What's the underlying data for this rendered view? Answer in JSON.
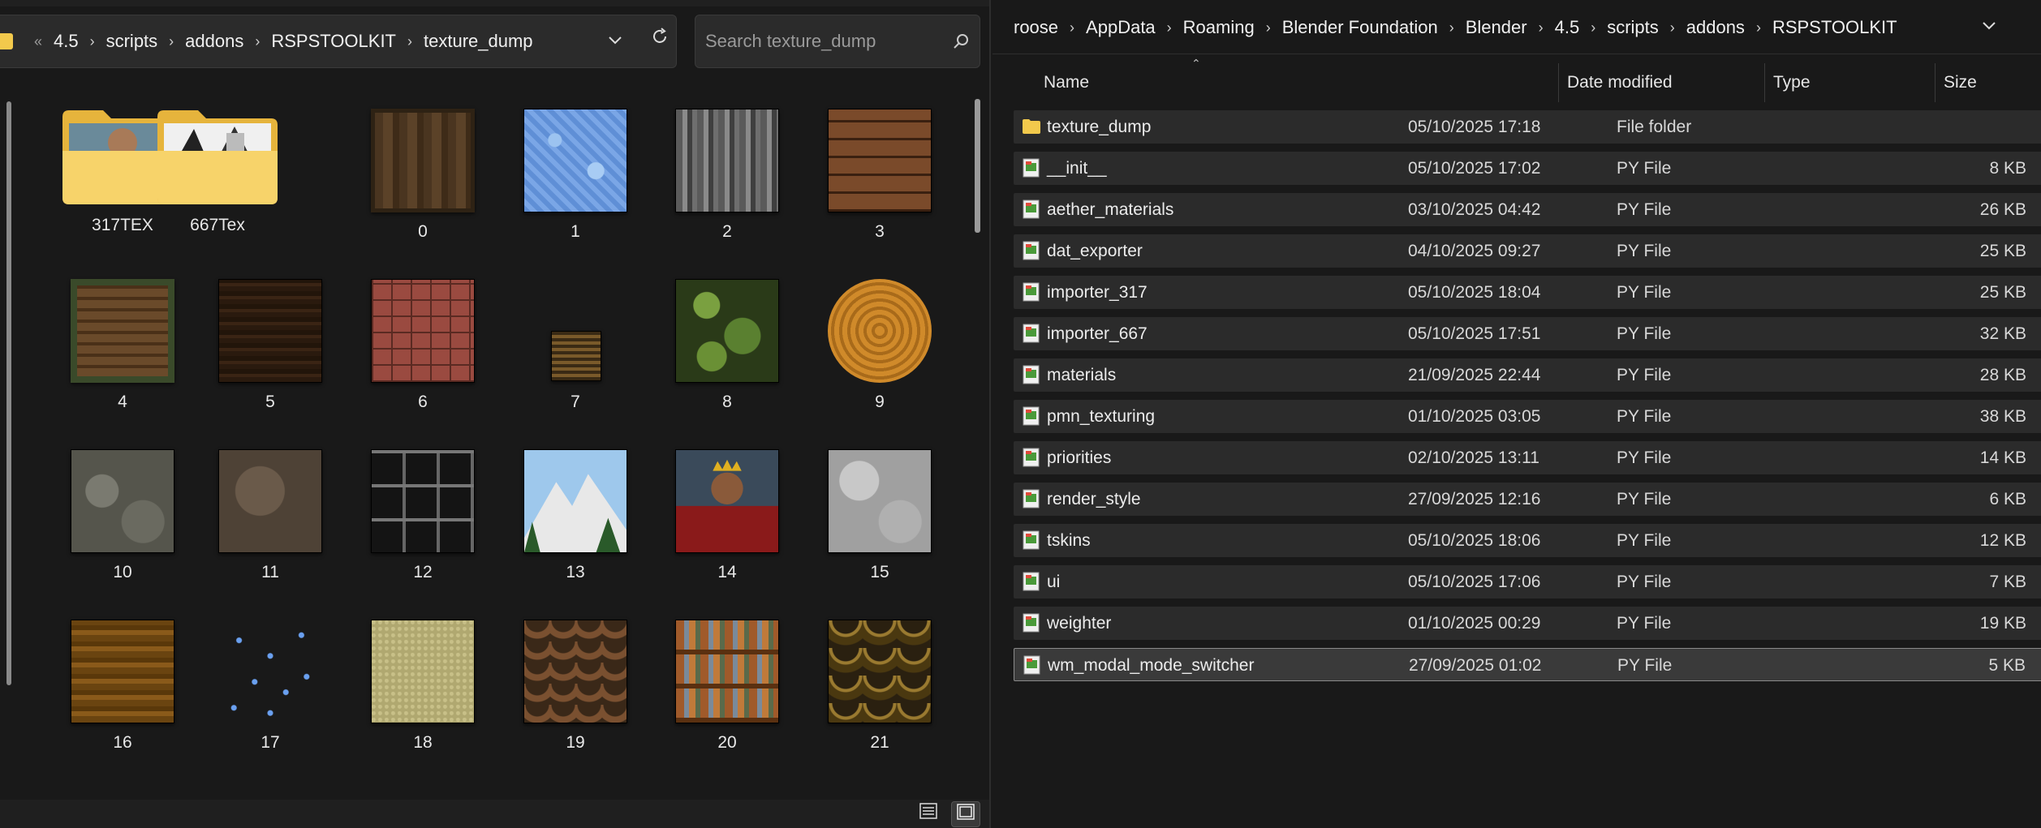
{
  "left": {
    "breadcrumb_overflow": "«",
    "breadcrumb": [
      "4.5",
      "scripts",
      "addons",
      "RSPSTOOLKIT",
      "texture_dump"
    ],
    "search_placeholder": "Search texture_dump",
    "tiles": [
      {
        "label": "317TEX",
        "kind": "folder"
      },
      {
        "label": "667Tex",
        "kind": "folder"
      },
      {
        "label": "0"
      },
      {
        "label": "1"
      },
      {
        "label": "2"
      },
      {
        "label": "3"
      },
      {
        "label": "4"
      },
      {
        "label": "5"
      },
      {
        "label": "6"
      },
      {
        "label": "7"
      },
      {
        "label": "8"
      },
      {
        "label": "9"
      },
      {
        "label": "10"
      },
      {
        "label": "11"
      },
      {
        "label": "12"
      },
      {
        "label": "13"
      },
      {
        "label": "14"
      },
      {
        "label": "15"
      },
      {
        "label": "16"
      },
      {
        "label": "17"
      },
      {
        "label": "18"
      },
      {
        "label": "19"
      },
      {
        "label": "20"
      },
      {
        "label": "21"
      }
    ]
  },
  "right": {
    "breadcrumb": [
      "roose",
      "AppData",
      "Roaming",
      "Blender Foundation",
      "Blender",
      "4.5",
      "scripts",
      "addons",
      "RSPSTOOLKIT"
    ],
    "columns": {
      "name": "Name",
      "date": "Date modified",
      "type": "Type",
      "size": "Size"
    },
    "files": [
      {
        "name": "texture_dump",
        "date": "05/10/2025 17:18",
        "type": "File folder",
        "size": "",
        "icon": "folder-icon"
      },
      {
        "name": "__init__",
        "date": "05/10/2025 17:02",
        "type": "PY File",
        "size": "8 KB",
        "icon": "python-file-icon"
      },
      {
        "name": "aether_materials",
        "date": "03/10/2025 04:42",
        "type": "PY File",
        "size": "26 KB",
        "icon": "python-file-icon"
      },
      {
        "name": "dat_exporter",
        "date": "04/10/2025 09:27",
        "type": "PY File",
        "size": "25 KB",
        "icon": "python-file-icon"
      },
      {
        "name": "importer_317",
        "date": "05/10/2025 18:04",
        "type": "PY File",
        "size": "25 KB",
        "icon": "python-file-icon"
      },
      {
        "name": "importer_667",
        "date": "05/10/2025 17:51",
        "type": "PY File",
        "size": "32 KB",
        "icon": "python-file-icon"
      },
      {
        "name": "materials",
        "date": "21/09/2025 22:44",
        "type": "PY File",
        "size": "28 KB",
        "icon": "python-file-icon"
      },
      {
        "name": "pmn_texturing",
        "date": "01/10/2025 03:05",
        "type": "PY File",
        "size": "38 KB",
        "icon": "python-file-icon"
      },
      {
        "name": "priorities",
        "date": "02/10/2025 13:11",
        "type": "PY File",
        "size": "14 KB",
        "icon": "python-file-icon"
      },
      {
        "name": "render_style",
        "date": "27/09/2025 12:16",
        "type": "PY File",
        "size": "6 KB",
        "icon": "python-file-icon"
      },
      {
        "name": "tskins",
        "date": "05/10/2025 18:06",
        "type": "PY File",
        "size": "12 KB",
        "icon": "python-file-icon"
      },
      {
        "name": "ui",
        "date": "05/10/2025 17:06",
        "type": "PY File",
        "size": "7 KB",
        "icon": "python-file-icon"
      },
      {
        "name": "weighter",
        "date": "01/10/2025 00:29",
        "type": "PY File",
        "size": "19 KB",
        "icon": "python-file-icon"
      },
      {
        "name": "wm_modal_mode_switcher",
        "date": "27/09/2025 01:02",
        "type": "PY File",
        "size": "5 KB",
        "icon": "python-file-icon",
        "selected": true
      }
    ]
  },
  "colors": {
    "accent_folder": "#f2c94c",
    "background": "#191919",
    "row": "#2b2b2b",
    "row_selected": "#3a3a3a"
  }
}
